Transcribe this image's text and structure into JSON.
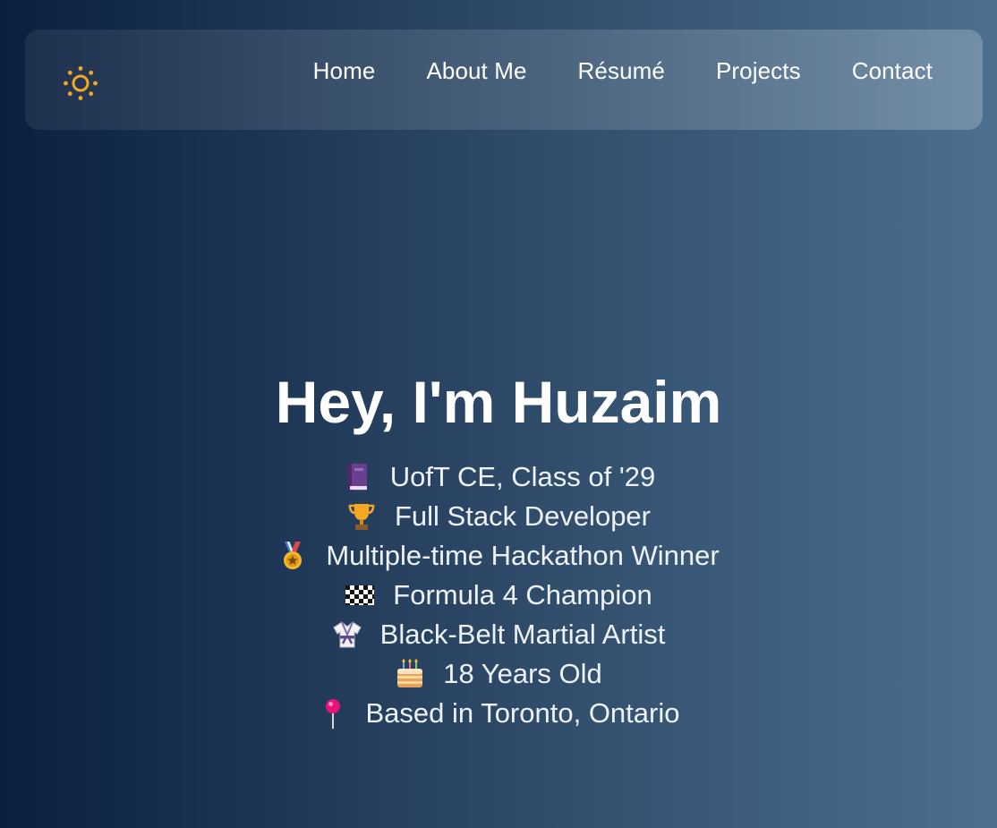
{
  "nav": {
    "theme_toggle_icon": "sun-icon",
    "links": [
      {
        "label": "Home"
      },
      {
        "label": "About Me"
      },
      {
        "label": "Résumé"
      },
      {
        "label": "Projects"
      },
      {
        "label": "Contact"
      }
    ]
  },
  "hero": {
    "title": "Hey, I'm Huzaim",
    "facts": [
      {
        "icon": "book-icon",
        "text": "UofT CE, Class of '29"
      },
      {
        "icon": "trophy-icon",
        "text": "Full Stack Developer"
      },
      {
        "icon": "medal-icon",
        "text": "Multiple-time Hackathon Winner"
      },
      {
        "icon": "checkered-flag-icon",
        "text": "Formula 4 Champion"
      },
      {
        "icon": "martial-arts-uniform-icon",
        "text": "Black-Belt Martial Artist"
      },
      {
        "icon": "birthday-cake-icon",
        "text": "18 Years Old"
      },
      {
        "icon": "location-pin-icon",
        "text": "Based in Toronto, Ontario"
      }
    ]
  },
  "colors": {
    "background_start": "#0b1f3f",
    "background_end": "#4d7090",
    "accent_sun": "#f5a623",
    "text": "#ffffff"
  }
}
